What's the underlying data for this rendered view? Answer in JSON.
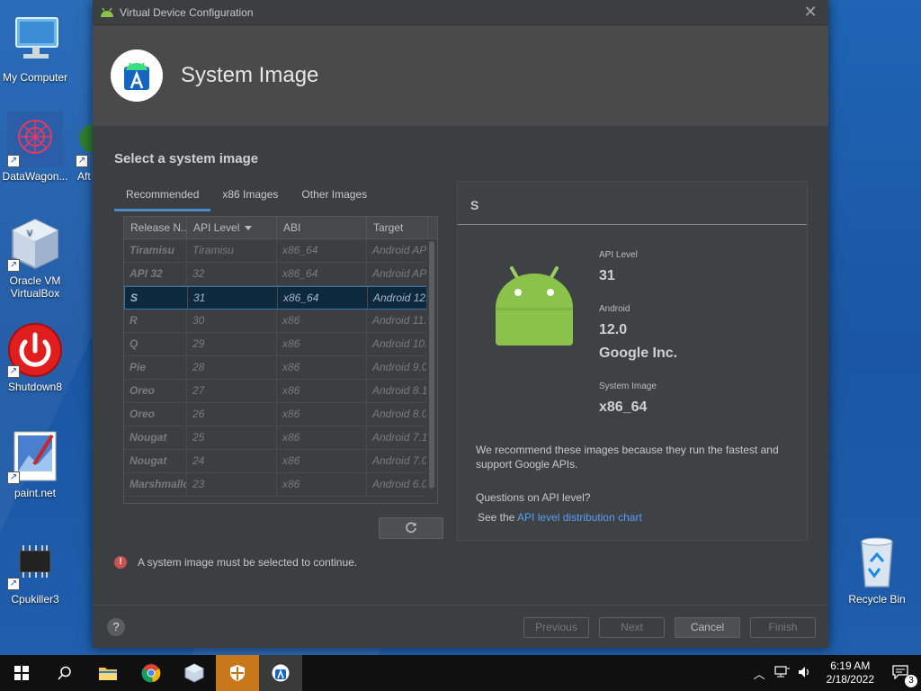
{
  "desktop": {
    "icons": [
      {
        "label": "My Computer"
      },
      {
        "label": "DataWagon..."
      },
      {
        "label": "Aft"
      },
      {
        "label": "Oracle VM VirtualBox"
      },
      {
        "label": "Shutdown8"
      },
      {
        "label": "paint.net"
      },
      {
        "label": "Cpukiller3"
      },
      {
        "label": "Recycle Bin"
      }
    ]
  },
  "dialog": {
    "window_title": "Virtual Device Configuration",
    "header_title": "System Image",
    "section_title": "Select a system image",
    "tabs": [
      "Recommended",
      "x86 Images",
      "Other Images"
    ],
    "table": {
      "columns": [
        "Release N...",
        "API Level",
        "ABI",
        "Target"
      ],
      "rows": [
        [
          "Tiramisu",
          "Tiramisu",
          "x86_64",
          "Android API"
        ],
        [
          "API 32",
          "32",
          "x86_64",
          "Android API"
        ],
        [
          "S",
          "31",
          "x86_64",
          "Android 12.0"
        ],
        [
          "R",
          "30",
          "x86",
          "Android 11.0"
        ],
        [
          "Q",
          "29",
          "x86",
          "Android 10.0"
        ],
        [
          "Pie",
          "28",
          "x86",
          "Android 9.0"
        ],
        [
          "Oreo",
          "27",
          "x86",
          "Android 8.1"
        ],
        [
          "Oreo",
          "26",
          "x86",
          "Android 8.0"
        ],
        [
          "Nougat",
          "25",
          "x86",
          "Android 7.1."
        ],
        [
          "Nougat",
          "24",
          "x86",
          "Android 7.0"
        ],
        [
          "Marshmallo",
          "23",
          "x86",
          "Android 6.0"
        ]
      ],
      "selected_index": 2
    },
    "refresh_icon": "refresh-icon",
    "detail": {
      "title": "S",
      "api_level_label": "API Level",
      "api_level_value": "31",
      "android_label": "Android",
      "android_version": "12.0",
      "vendor": "Google Inc.",
      "system_image_label": "System Image",
      "system_image_value": "x86_64",
      "recommend_text": "We recommend these images because they run the fastest and support Google APIs.",
      "question": "Questions on API level?",
      "see_the": "See the",
      "link": "API level distribution chart"
    },
    "error_text": "A system image must be selected to continue.",
    "buttons": {
      "help": "?",
      "previous": "Previous",
      "next": "Next",
      "cancel": "Cancel",
      "finish": "Finish"
    }
  },
  "taskbar": {
    "time": "6:19 AM",
    "date": "2/18/2022",
    "notification_count": "3"
  },
  "colors": {
    "accent": "#4a88c7",
    "android_green": "#8bc34a",
    "link": "#589df6",
    "error": "#c75450",
    "selected_row": "#0d293e"
  }
}
